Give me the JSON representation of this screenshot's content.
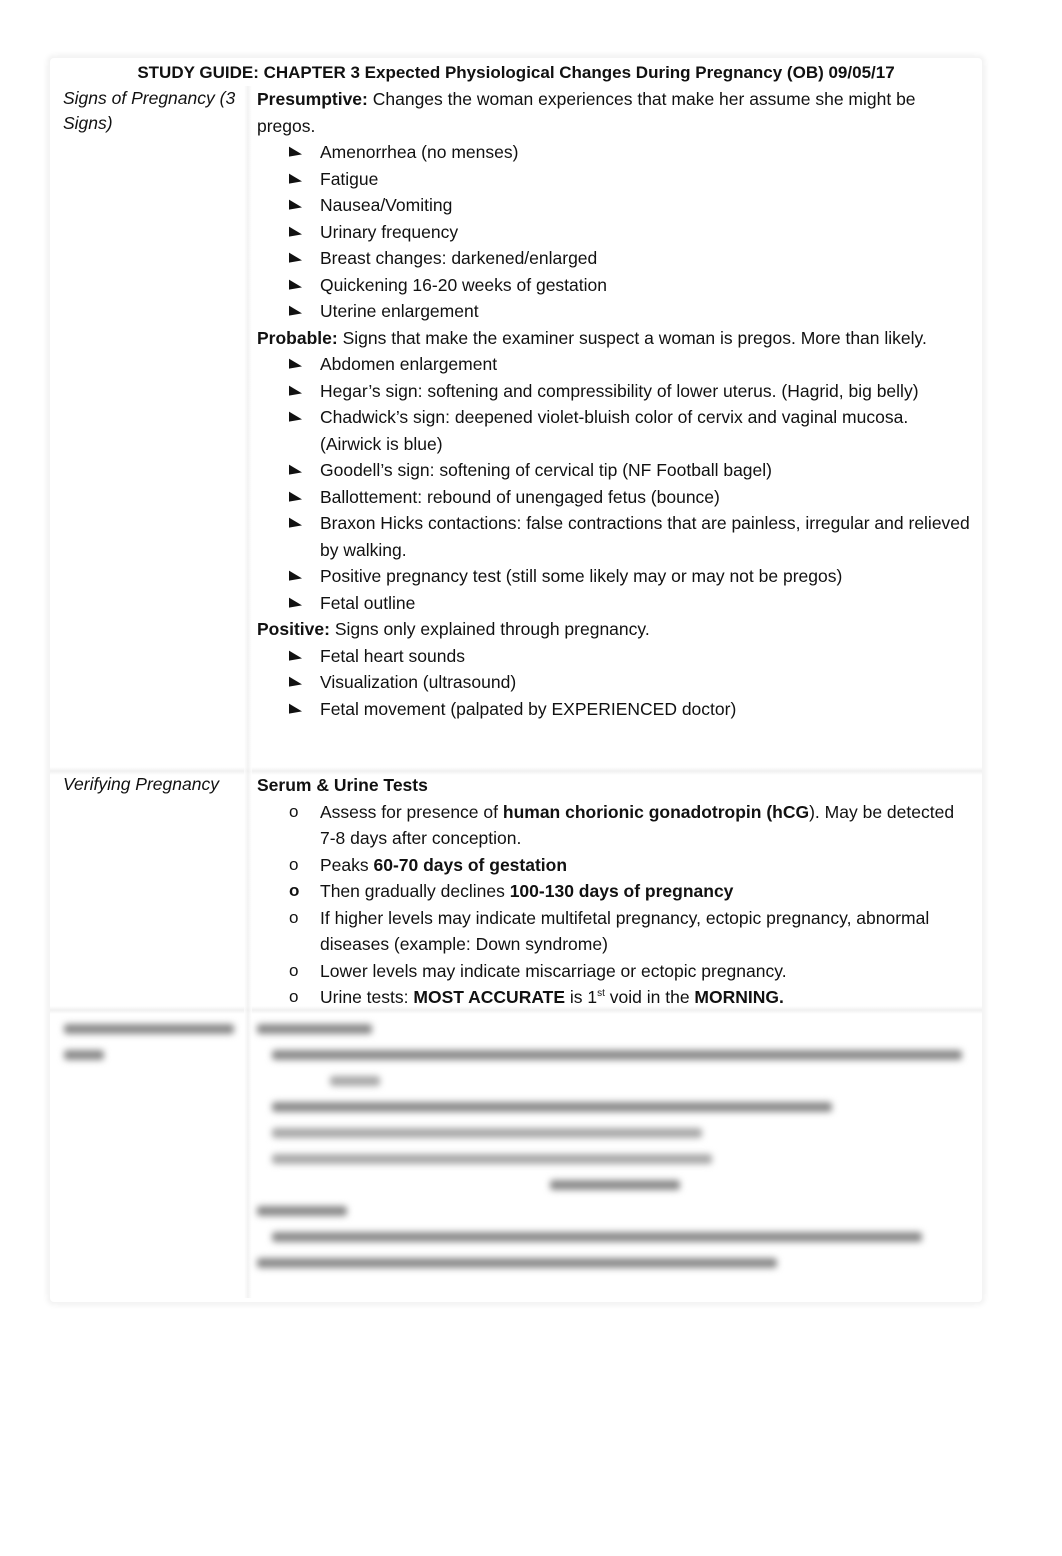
{
  "document": {
    "title": "STUDY GUIDE: CHAPTER 3 Expected Physiological Changes During Pregnancy (OB) 09/05/17"
  },
  "sections": [
    {
      "label": "Signs of Pregnancy (3 Signs)",
      "groups": [
        {
          "heading": "Presumptive:",
          "text": " Changes the woman experiences that make her assume she might be pregos.",
          "bullet_icon": "arrowhead-bullet-icon",
          "items": [
            "Amenorrhea (no menses)",
            "Fatigue",
            "Nausea/Vomiting",
            "Urinary frequency",
            "Breast changes: darkened/enlarged",
            "Quickening 16-20 weeks of gestation",
            "Uterine enlargement"
          ]
        },
        {
          "heading": "Probable:",
          "text": " Signs that make the examiner suspect a woman is pregos. More than likely.",
          "bullet_icon": "arrowhead-bullet-icon",
          "items": [
            "Abdomen enlargement",
            "Hegar’s sign: softening and compressibility of lower uterus. (Hagrid, big belly)",
            "Chadwick’s sign: deepened violet-bluish color of cervix and vaginal mucosa. (Airwick is blue)",
            "Goodell’s sign: softening of cervical tip (NF Football bagel)",
            "Ballottement: rebound of unengaged fetus (bounce)",
            "Braxon Hicks contactions: false contractions that are painless, irregular and relieved by walking.",
            "Positive pregnancy test (still some likely may or may not be pregos)",
            "Fetal outline"
          ]
        },
        {
          "heading": "Positive:",
          "text": " Signs only explained through pregnancy.",
          "bullet_icon": "arrowhead-bullet-icon",
          "items": [
            "Fetal heart sounds",
            "Visualization (ultrasound)",
            "Fetal movement (palpated by EXPERIENCED doctor)"
          ]
        }
      ]
    },
    {
      "label": "Verifying Pregnancy",
      "heading": "Serum & Urine Tests",
      "bullet_icon": "circle-bullet-icon",
      "items": [
        {
          "parts": [
            {
              "t": "Assess for presence of ",
              "b": false
            },
            {
              "t": "human chorionic gonadotropin (hCG",
              "b": true
            },
            {
              "t": "). May be detected 7-8 days after conception.",
              "b": false
            }
          ]
        },
        {
          "parts": [
            {
              "t": "Peaks ",
              "b": false
            },
            {
              "t": "60-70 days of gestation",
              "b": true
            }
          ]
        },
        {
          "parts": [
            {
              "t": "Then gradually declines ",
              "b": false
            },
            {
              "t": "100-130 days of pregnancy",
              "b": true
            }
          ],
          "bold_bullet": true
        },
        {
          "parts": [
            {
              "t": "If higher levels may indicate multifetal pregnancy, ectopic pregnancy, abnormal diseases (example: Down syndrome)",
              "b": false
            }
          ]
        },
        {
          "parts": [
            {
              "t": "Lower levels may indicate miscarriage or ectopic pregnancy.",
              "b": false
            }
          ]
        },
        {
          "parts": [
            {
              "t": "Urine tests: ",
              "b": false
            },
            {
              "t": "MOST ACCURATE",
              "b": true
            },
            {
              "t": "  is 1",
              "b": false
            },
            {
              "t": "st",
              "b": false,
              "sup": true
            },
            {
              "t": " void in the ",
              "b": false
            },
            {
              "t": "MORNING.",
              "b": true
            }
          ]
        }
      ]
    },
    {
      "label": "",
      "obscured": true
    }
  ]
}
